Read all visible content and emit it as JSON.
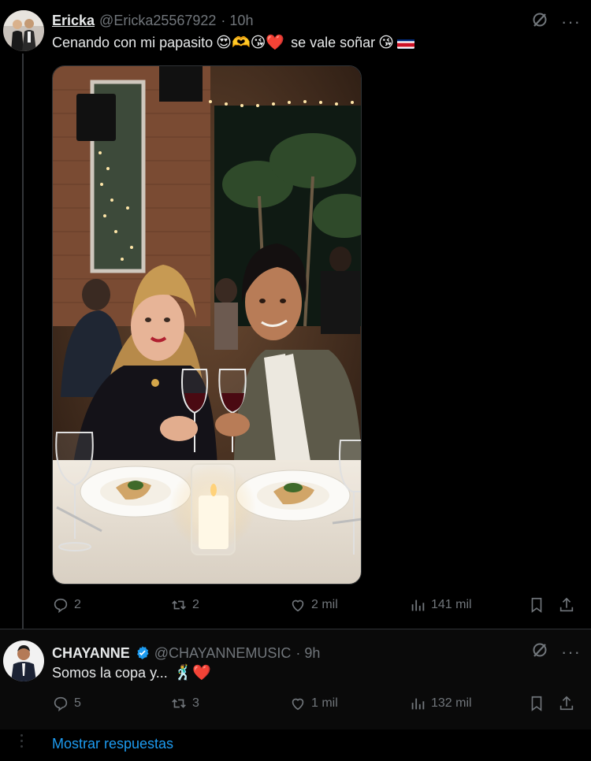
{
  "post": {
    "display_name": "Ericka",
    "handle": "@Ericka25567922",
    "time": "· 10h",
    "text_before": "Cenando con mi papasito",
    "emojis_before": "😍🫶😘❤️",
    "text_after": "se vale soñar",
    "emoji_after": "😘",
    "flag": "costa-rica-flag-icon",
    "media_alt": "photo of couple dining with wine glasses",
    "stats": {
      "replies": "2",
      "reposts": "2",
      "likes": "2 mil",
      "views": "141 mil"
    }
  },
  "reply": {
    "display_name": "CHAYANNE",
    "verified": true,
    "handle": "@CHAYANNEMUSIC",
    "time": "· 9h",
    "text": "Somos la copa y...",
    "emojis": "🕺❤️",
    "stats": {
      "replies": "5",
      "reposts": "3",
      "likes": "1 mil",
      "views": "132 mil"
    }
  },
  "show_replies": "Mostrar respuestas",
  "colors": {
    "background": "#000000",
    "muted": "#71767b",
    "accent": "#1d9bf0",
    "text": "#e7e9ea"
  }
}
